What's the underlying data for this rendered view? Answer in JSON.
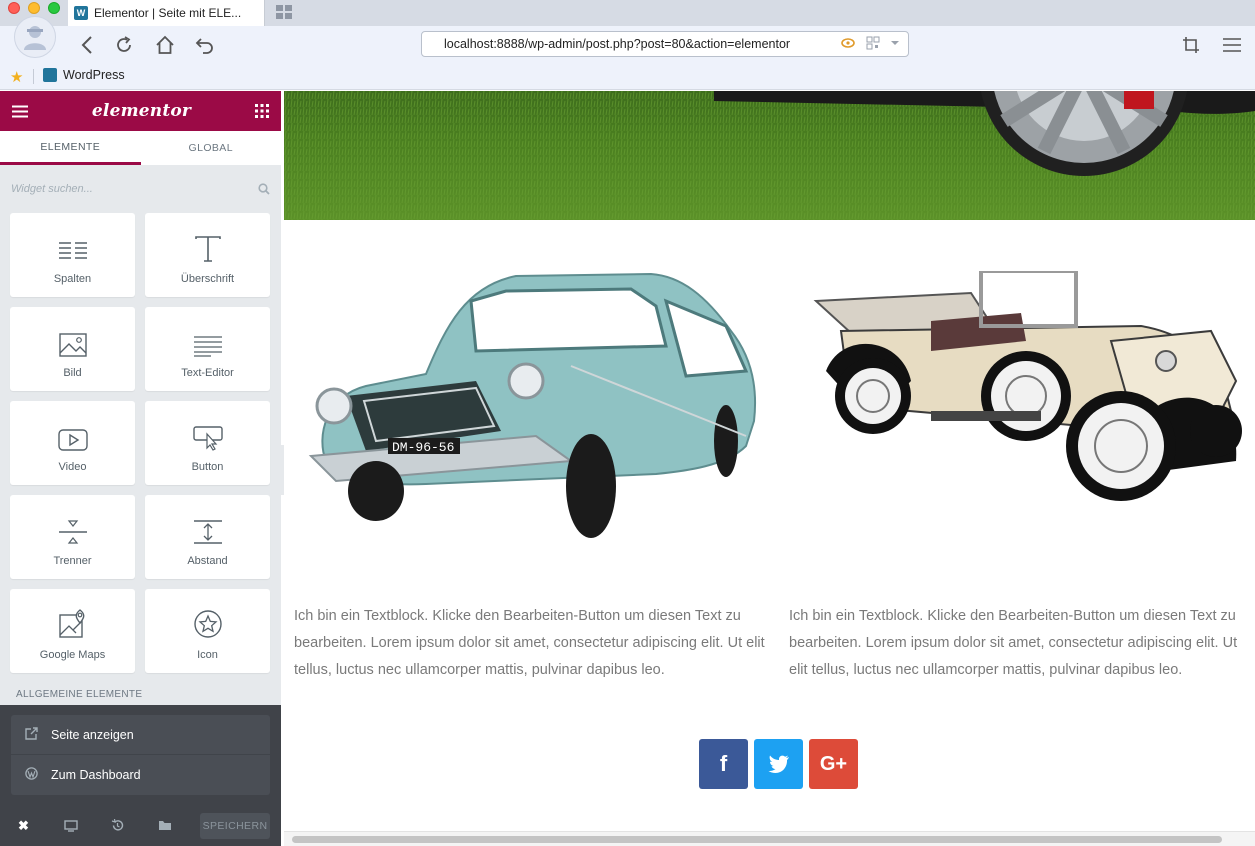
{
  "browser": {
    "tab_title": "Elementor | Seite mit ELE...",
    "url": "localhost:8888/wp-admin/post.php?post=80&action=elementor",
    "bookmark_label": "WordPress"
  },
  "panel": {
    "logo": "elementor",
    "tabs": [
      "ELEMENTE",
      "GLOBAL"
    ],
    "search_placeholder": "Widget suchen...",
    "widgets": [
      {
        "label": "Spalten",
        "icon": "columns-icon"
      },
      {
        "label": "Überschrift",
        "icon": "heading-icon"
      },
      {
        "label": "Bild",
        "icon": "image-icon"
      },
      {
        "label": "Text-Editor",
        "icon": "text-editor-icon"
      },
      {
        "label": "Video",
        "icon": "video-icon"
      },
      {
        "label": "Button",
        "icon": "button-icon"
      },
      {
        "label": "Trenner",
        "icon": "divider-icon"
      },
      {
        "label": "Abstand",
        "icon": "spacer-icon"
      },
      {
        "label": "Google Maps",
        "icon": "map-icon"
      },
      {
        "label": "Icon",
        "icon": "star-icon"
      }
    ],
    "section_title": "ALLGEMEINE ELEMENTE",
    "menu": [
      "Seite anzeigen",
      "Zum Dashboard"
    ],
    "save_label": "SPEICHERN"
  },
  "preview": {
    "text_left": "Ich bin ein Textblock. Klicke den Bearbeiten-Button um diesen Text zu bearbeiten. Lorem ipsum dolor sit amet, consectetur adipiscing elit. Ut elit tellus, luctus nec ullamcorper mattis, pulvinar dapibus leo.",
    "text_right": "Ich bin ein Textblock. Klicke den Bearbeiten-Button um diesen Text zu bearbeiten. Lorem ipsum dolor sit amet, consectetur adipiscing elit. Ut elit tellus, luctus nec ullamcorper mattis, pulvinar dapibus leo.",
    "license_plate": "DM-96-56",
    "social": [
      {
        "label": "f",
        "color": "#3b5998"
      },
      {
        "label": "t",
        "color": "#1da1f2"
      },
      {
        "label": "G+",
        "color": "#dd4b39"
      }
    ]
  },
  "colors": {
    "brand": "#9b0a46",
    "panel_bg": "#e6e9ec",
    "panel_dark": "#404349"
  }
}
